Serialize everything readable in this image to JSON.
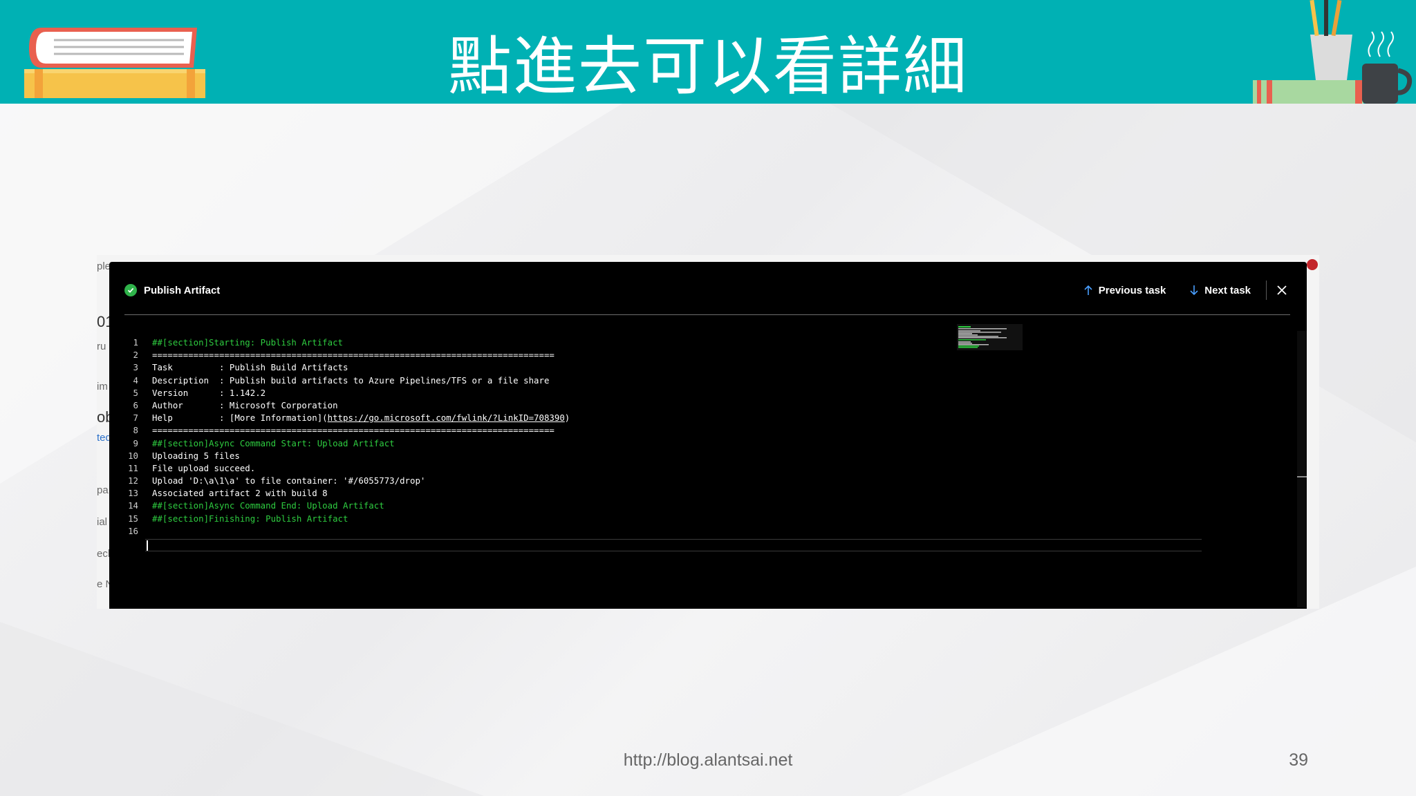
{
  "slide": {
    "title": "點進去可以看詳細",
    "footer_url": "http://blog.alantsai.net",
    "page_number": "39",
    "colors": {
      "header": "#00b1b4",
      "background": "#f2f2f3"
    }
  },
  "background_fragments": [
    "ple",
    "01",
    "ru",
    "im",
    "ob",
    "ted",
    "pa",
    "ial",
    "eck",
    "e N"
  ],
  "log_panel": {
    "task_title": "Publish Artifact",
    "status_icon": "check-circle-icon",
    "previous_label": "Previous task",
    "next_label": "Next task",
    "lines": [
      {
        "n": "1",
        "text": "##[section]Starting: Publish Artifact",
        "style": "section"
      },
      {
        "n": "2",
        "text": "==============================================================================",
        "style": "plain"
      },
      {
        "n": "3",
        "text": "Task         : Publish Build Artifacts",
        "style": "plain"
      },
      {
        "n": "4",
        "text": "Description  : Publish build artifacts to Azure Pipelines/TFS or a file share",
        "style": "plain"
      },
      {
        "n": "5",
        "text": "Version      : 1.142.2",
        "style": "plain"
      },
      {
        "n": "6",
        "text": "Author       : Microsoft Corporation",
        "style": "plain"
      },
      {
        "n": "7",
        "text": "Help         : [More Information](",
        "link": "https://go.microsoft.com/fwlink/?LinkID=708390",
        "tail": ")",
        "style": "plain"
      },
      {
        "n": "8",
        "text": "==============================================================================",
        "style": "plain"
      },
      {
        "n": "9",
        "text": "##[section]Async Command Start: Upload Artifact",
        "style": "section"
      },
      {
        "n": "10",
        "text": "Uploading 5 files",
        "style": "plain"
      },
      {
        "n": "11",
        "text": "File upload succeed.",
        "style": "plain"
      },
      {
        "n": "12",
        "text": "Upload 'D:\\a\\1\\a' to file container: '#/6055773/drop'",
        "style": "plain"
      },
      {
        "n": "13",
        "text": "Associated artifact 2 with build 8",
        "style": "plain"
      },
      {
        "n": "14",
        "text": "##[section]Async Command End: Upload Artifact",
        "style": "section"
      },
      {
        "n": "15",
        "text": "##[section]Finishing: Publish Artifact",
        "style": "section"
      },
      {
        "n": "16",
        "text": "",
        "style": "plain"
      }
    ]
  }
}
